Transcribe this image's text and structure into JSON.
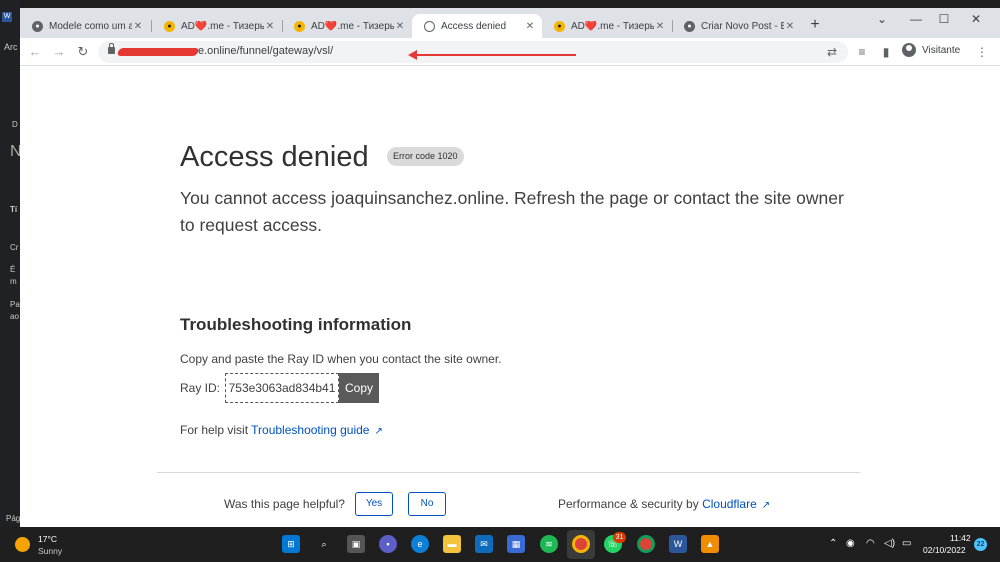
{
  "background_app": {
    "lines": [
      "Arc",
      "D",
      "N",
      "Tí",
      "Cr",
      "É",
      "m",
      "Pa",
      "ao",
      "Pág"
    ]
  },
  "browser": {
    "tabs": [
      {
        "title": "Modele como um ar",
        "icon": "github-icon"
      },
      {
        "title": "AD❤️.me - Тизеры",
        "icon": "adme-icon"
      },
      {
        "title": "AD❤️.me - Тизеры",
        "icon": "adme-icon"
      },
      {
        "title": "Access denied",
        "icon": "globe-icon"
      },
      {
        "title": "AD❤️.me - Тизеры",
        "icon": "adme-icon"
      },
      {
        "title": "Criar Novo Post - Bla",
        "icon": "github-icon"
      }
    ],
    "new_tab": "+",
    "window_controls": {
      "chevron": "⌄",
      "minimize": "—",
      "maximize": "☐",
      "close": "✕"
    },
    "toolbar": {
      "back": "←",
      "forward": "→",
      "reload": "↻",
      "url_visible": "e.online/funnel/gateway/vsl/",
      "profile_label": "Visitante"
    }
  },
  "page": {
    "title": "Access denied",
    "error_badge": "Error code 1020",
    "lead": "You cannot access joaquinsanchez.online. Refresh the page or contact the site owner to request access.",
    "troubleshooting_heading": "Troubleshooting information",
    "troubleshooting_text": "Copy and paste the Ray ID when you contact the site owner.",
    "ray_label": "Ray ID:",
    "ray_id": "753e3063ad834b41",
    "copy_label": "Copy",
    "help_prefix": "For help visit",
    "help_link": "Troubleshooting guide",
    "helpful_question": "Was this page helpful?",
    "yes_label": "Yes",
    "no_label": "No",
    "footer_prefix": "Performance & security by",
    "footer_link": "Cloudflare"
  },
  "taskbar": {
    "temperature": "17°C",
    "condition": "Sunny",
    "chrome_badge": "31",
    "time": "11:42",
    "date": "02/10/2022",
    "notifications": "22"
  }
}
